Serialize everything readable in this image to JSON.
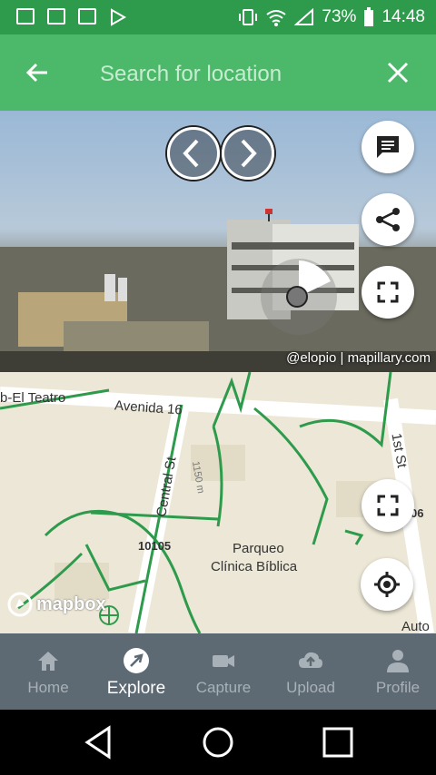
{
  "status_bar": {
    "battery": "73%",
    "time": "14:48"
  },
  "search": {
    "placeholder": "Search for location"
  },
  "photo": {
    "credit": "@elopio | mapillary.com"
  },
  "map": {
    "labels": {
      "el_teatro": "b-El Teatro",
      "avenida": "Avenida 16",
      "central_st": "Central St",
      "first_st": "1st St",
      "scale": "1150 m",
      "postal": "10105",
      "poi_line1": "Parqueo",
      "poi_line2": "Clínica Bíblica",
      "num_edge": "06",
      "auto_edge": "Auto"
    },
    "attribution": "mapbox"
  },
  "bottom_nav": {
    "items": [
      {
        "label": "Home",
        "icon": "home-icon"
      },
      {
        "label": "Explore",
        "icon": "explore-icon"
      },
      {
        "label": "Capture",
        "icon": "video-camera-icon"
      },
      {
        "label": "Upload",
        "icon": "cloud-upload-icon"
      },
      {
        "label": "Profile",
        "icon": "person-icon"
      }
    ],
    "active": "Explore"
  },
  "colors": {
    "status_bar": "#2e9a4c",
    "app_bar": "#4cb96a",
    "bottom_nav": "#5d6a73",
    "track": "#2e9a4c"
  }
}
